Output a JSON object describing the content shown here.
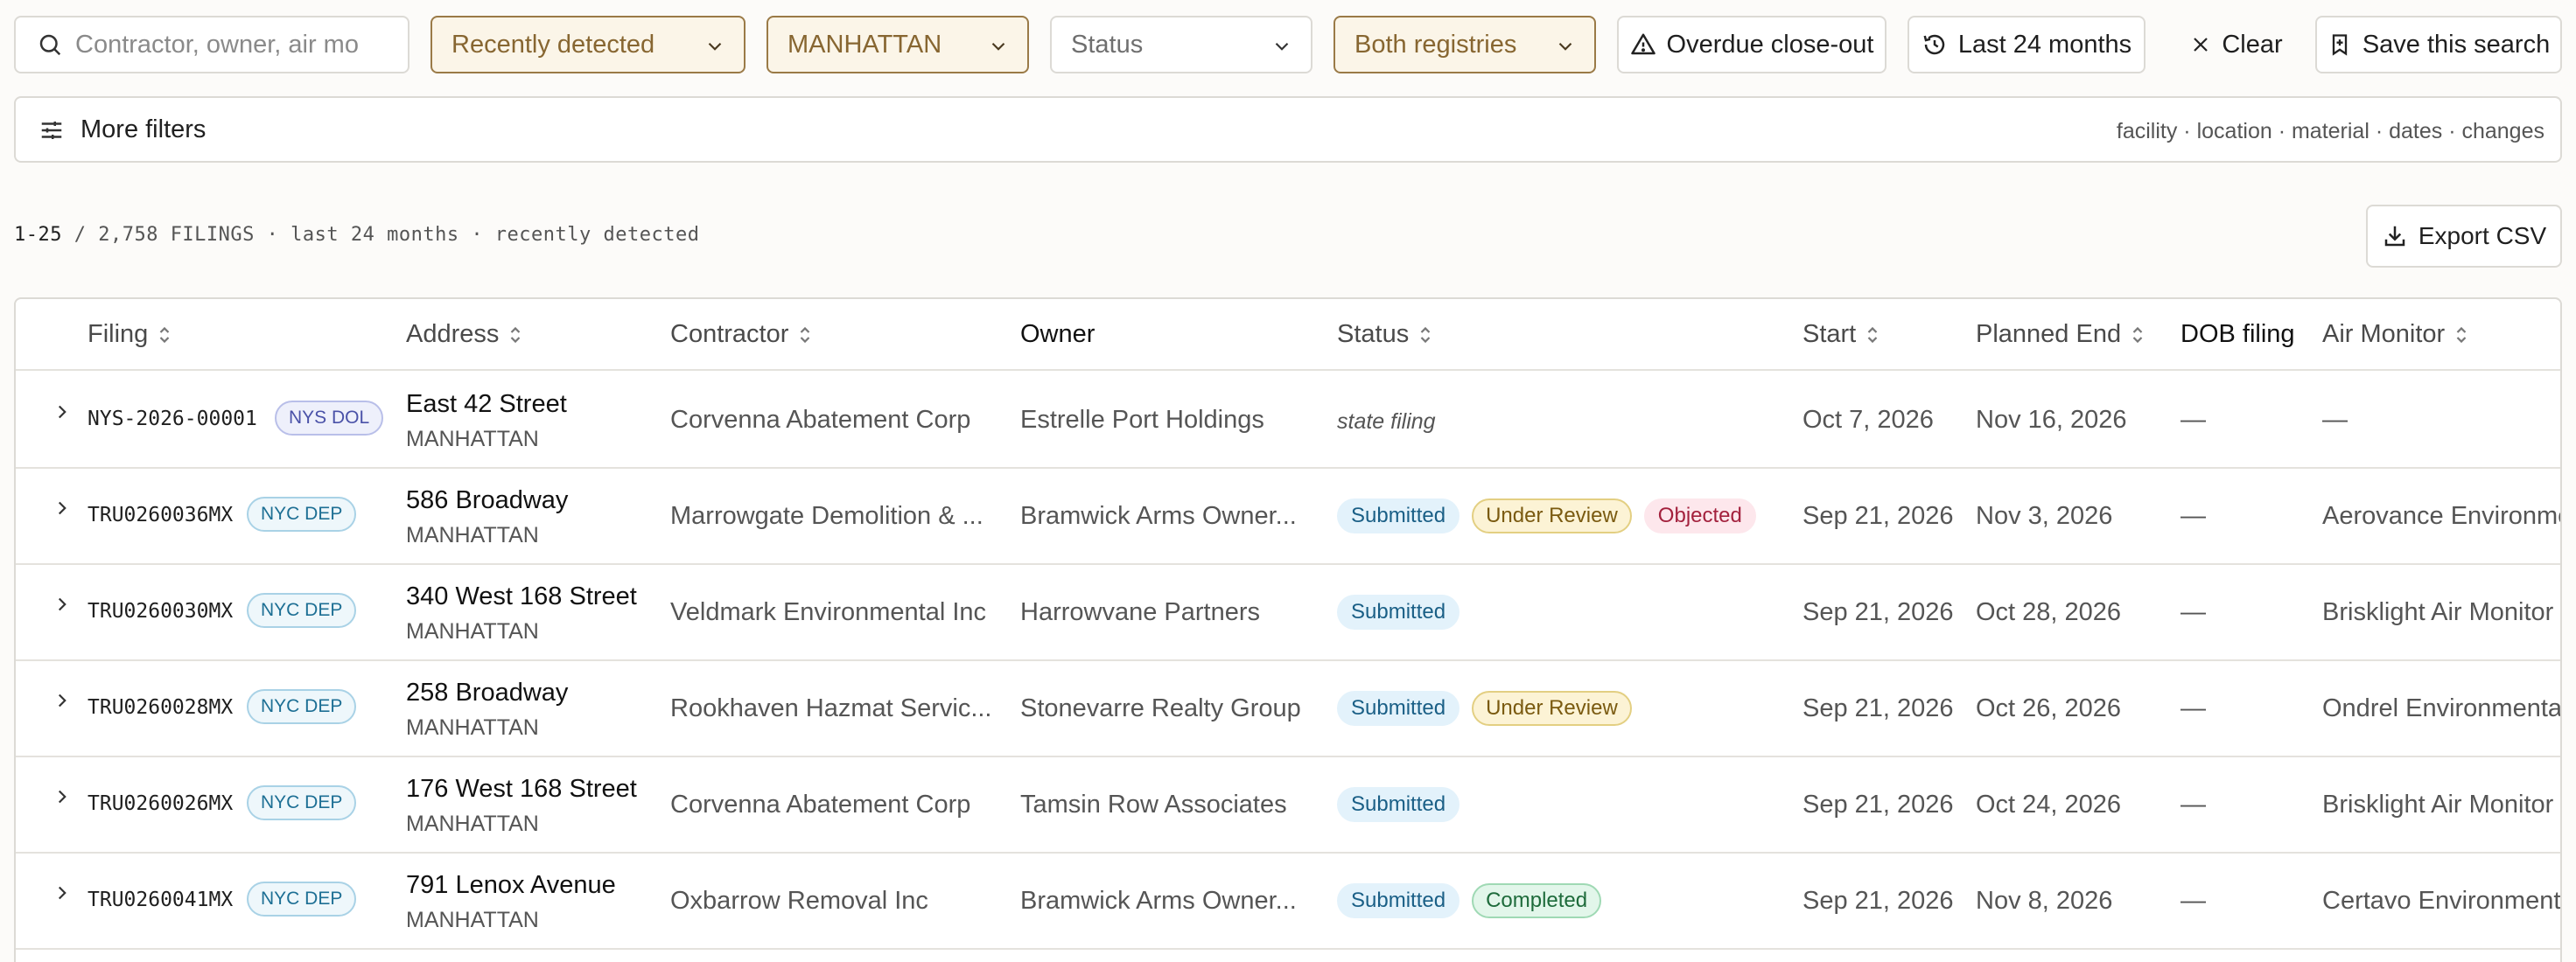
{
  "filters": {
    "search_placeholder": "Contractor, owner, air mo",
    "sort": "Recently detected",
    "borough": "MANHATTAN",
    "status": "Status",
    "registry": "Both registries",
    "overdue": "Overdue close-out",
    "period": "Last 24 months",
    "clear": "Clear",
    "save": "Save this search"
  },
  "more_filters": {
    "label": "More filters",
    "hint": "facility · location · material · dates · changes"
  },
  "summary": {
    "range": "1-25",
    "rest": " / 2,758 FILINGS · last 24 months · recently detected"
  },
  "export_label": "Export CSV",
  "columns": {
    "filing": "Filing",
    "address": "Address",
    "contractor": "Contractor",
    "owner": "Owner",
    "status": "Status",
    "start": "Start",
    "planned_end": "Planned End",
    "dob_filing": "DOB filing",
    "air_monitor": "Air Monitor"
  },
  "rows": [
    {
      "filing": "NYS-2026-00001",
      "source": "NYS DOL",
      "street": "East 42 Street",
      "borough": "MANHATTAN",
      "contractor": "Corvenna Abatement Corp",
      "owner": "Estrelle Port Holdings",
      "state_filing": "state filing",
      "statuses": [],
      "start": "Oct 7, 2026",
      "end": "Nov 16, 2026",
      "dob": "—",
      "air": "—"
    },
    {
      "filing": "TRU0260036MX",
      "source": "NYC DEP",
      "street": "586 Broadway",
      "borough": "MANHATTAN",
      "contractor": "Marrowgate Demolition & ...",
      "owner": "Bramwick Arms Owner...",
      "state_filing": "",
      "statuses": [
        "Submitted",
        "Under Review",
        "Objected"
      ],
      "start": "Sep 21, 2026",
      "end": "Nov 3, 2026",
      "dob": "—",
      "air": "Aerovance Environme"
    },
    {
      "filing": "TRU0260030MX",
      "source": "NYC DEP",
      "street": "340 West 168 Street",
      "borough": "MANHATTAN",
      "contractor": "Veldmark Environmental Inc",
      "owner": "Harrowvane Partners",
      "state_filing": "",
      "statuses": [
        "Submitted"
      ],
      "start": "Sep 21, 2026",
      "end": "Oct 28, 2026",
      "dob": "—",
      "air": "Brisklight Air Monitor"
    },
    {
      "filing": "TRU0260028MX",
      "source": "NYC DEP",
      "street": "258 Broadway",
      "borough": "MANHATTAN",
      "contractor": "Rookhaven Hazmat Servic...",
      "owner": "Stonevarre Realty Group",
      "state_filing": "",
      "statuses": [
        "Submitted",
        "Under Review"
      ],
      "start": "Sep 21, 2026",
      "end": "Oct 26, 2026",
      "dob": "—",
      "air": "Ondrel Environmenta"
    },
    {
      "filing": "TRU0260026MX",
      "source": "NYC DEP",
      "street": "176 West 168 Street",
      "borough": "MANHATTAN",
      "contractor": "Corvenna Abatement Corp",
      "owner": "Tamsin Row Associates",
      "state_filing": "",
      "statuses": [
        "Submitted"
      ],
      "start": "Sep 21, 2026",
      "end": "Oct 24, 2026",
      "dob": "—",
      "air": "Brisklight Air Monitor"
    },
    {
      "filing": "TRU0260041MX",
      "source": "NYC DEP",
      "street": "791 Lenox Avenue",
      "borough": "MANHATTAN",
      "contractor": "Oxbarrow Removal Inc",
      "owner": "Bramwick Arms Owner...",
      "state_filing": "",
      "statuses": [
        "Submitted",
        "Completed"
      ],
      "start": "Sep 21, 2026",
      "end": "Nov 8, 2026",
      "dob": "—",
      "air": "Certavo Environment"
    }
  ]
}
